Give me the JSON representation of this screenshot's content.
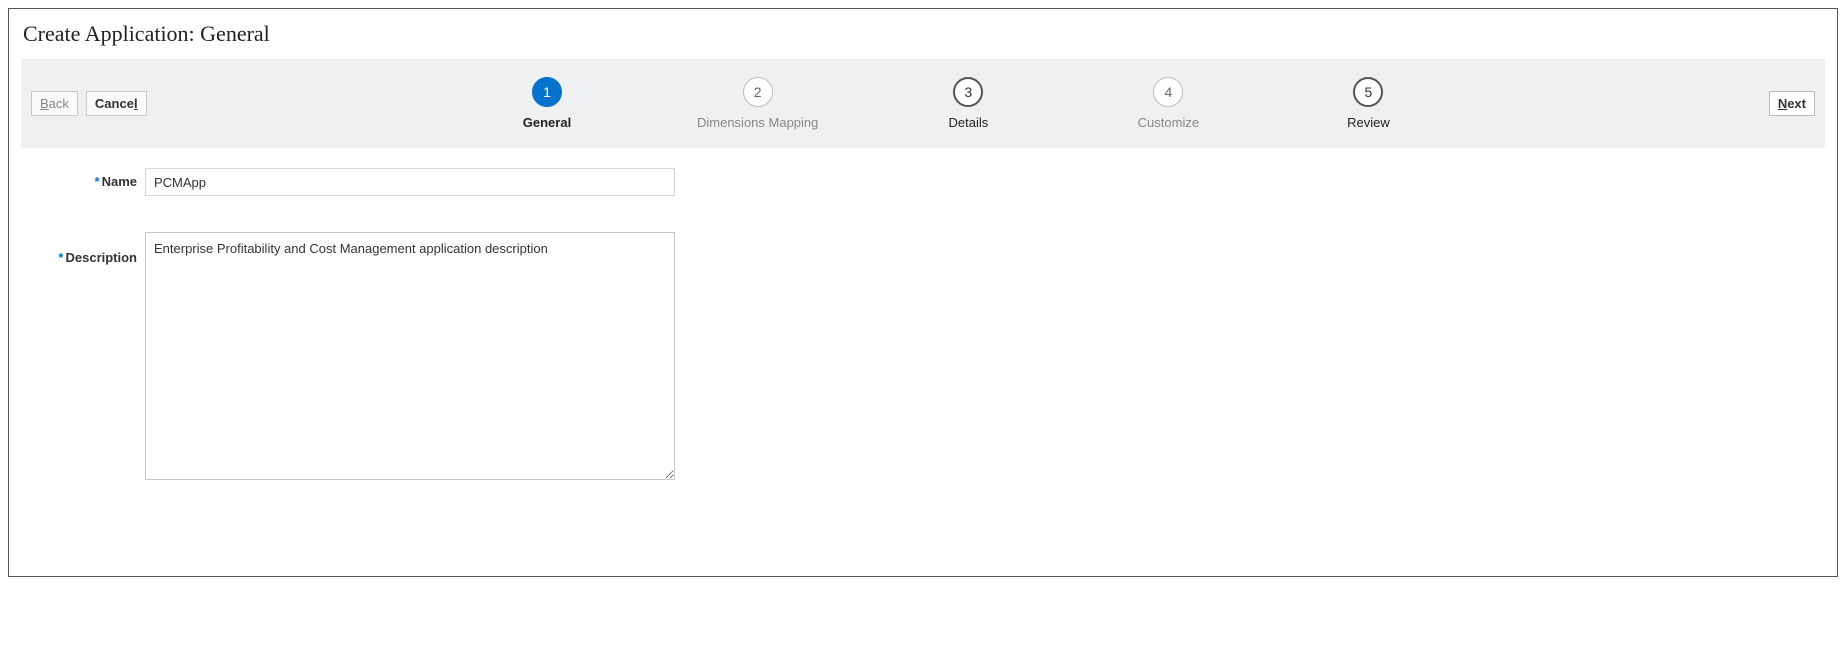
{
  "page": {
    "title": "Create Application: General"
  },
  "nav": {
    "back_label": "Back",
    "cancel_label": "Cancel",
    "next_label": "Next"
  },
  "steps": [
    {
      "num": "1",
      "label": "General",
      "state": "active"
    },
    {
      "num": "2",
      "label": "Dimensions Mapping",
      "state": "disabled"
    },
    {
      "num": "3",
      "label": "Details",
      "state": "enabled"
    },
    {
      "num": "4",
      "label": "Customize",
      "state": "disabled"
    },
    {
      "num": "5",
      "label": "Review",
      "state": "enabled"
    }
  ],
  "form": {
    "name_label": "Name",
    "name_value": "PCMApp",
    "description_label": "Description",
    "description_value": "Enterprise Profitability and Cost Management application description"
  },
  "required_marker": "*"
}
